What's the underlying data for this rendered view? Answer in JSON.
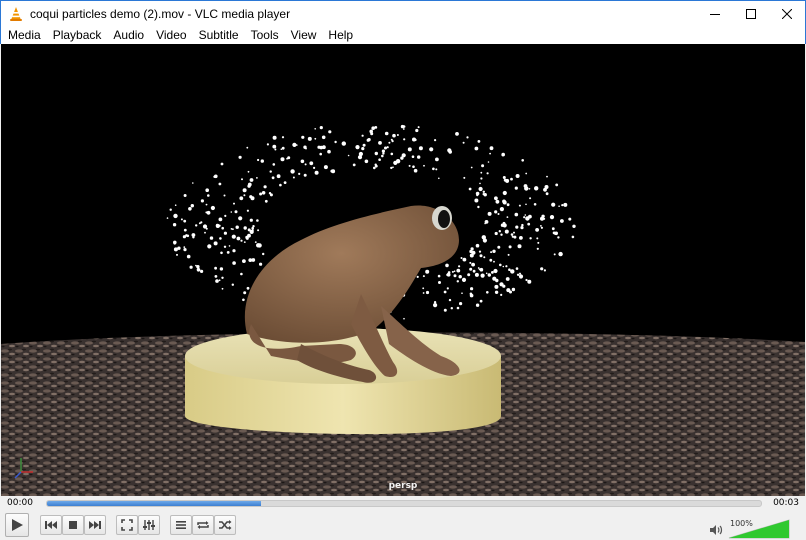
{
  "window": {
    "title": "coqui particles demo (2).mov - VLC media player",
    "accent_border": "#2b78d6"
  },
  "window_controls": {
    "icons": [
      "minimize-icon",
      "maximize-icon",
      "close-icon"
    ]
  },
  "menu": {
    "items": [
      "Media",
      "Playback",
      "Audio",
      "Video",
      "Subtitle",
      "Tools",
      "View",
      "Help"
    ]
  },
  "video": {
    "overlay_label": "persp",
    "scene": "3D frog on a cylindrical pedestal surrounded by white particles over textured ground"
  },
  "seek": {
    "current_time": "00:00",
    "total_time": "00:03",
    "progress": 0.3
  },
  "controls": {
    "buttons": [
      {
        "name": "play-button",
        "icon": "play-icon"
      },
      {
        "name": "previous-button",
        "icon": "skip-back-icon"
      },
      {
        "name": "stop-button",
        "icon": "stop-icon"
      },
      {
        "name": "next-button",
        "icon": "skip-forward-icon"
      },
      {
        "name": "fullscreen-button",
        "icon": "fullscreen-icon"
      },
      {
        "name": "extended-settings-button",
        "icon": "equalizer-icon"
      },
      {
        "name": "playlist-button",
        "icon": "playlist-icon"
      },
      {
        "name": "loop-button",
        "icon": "loop-icon"
      },
      {
        "name": "shuffle-button",
        "icon": "shuffle-icon"
      }
    ]
  },
  "volume": {
    "percent_label": "100%",
    "level": 1.0,
    "color": "#2fc92f"
  }
}
